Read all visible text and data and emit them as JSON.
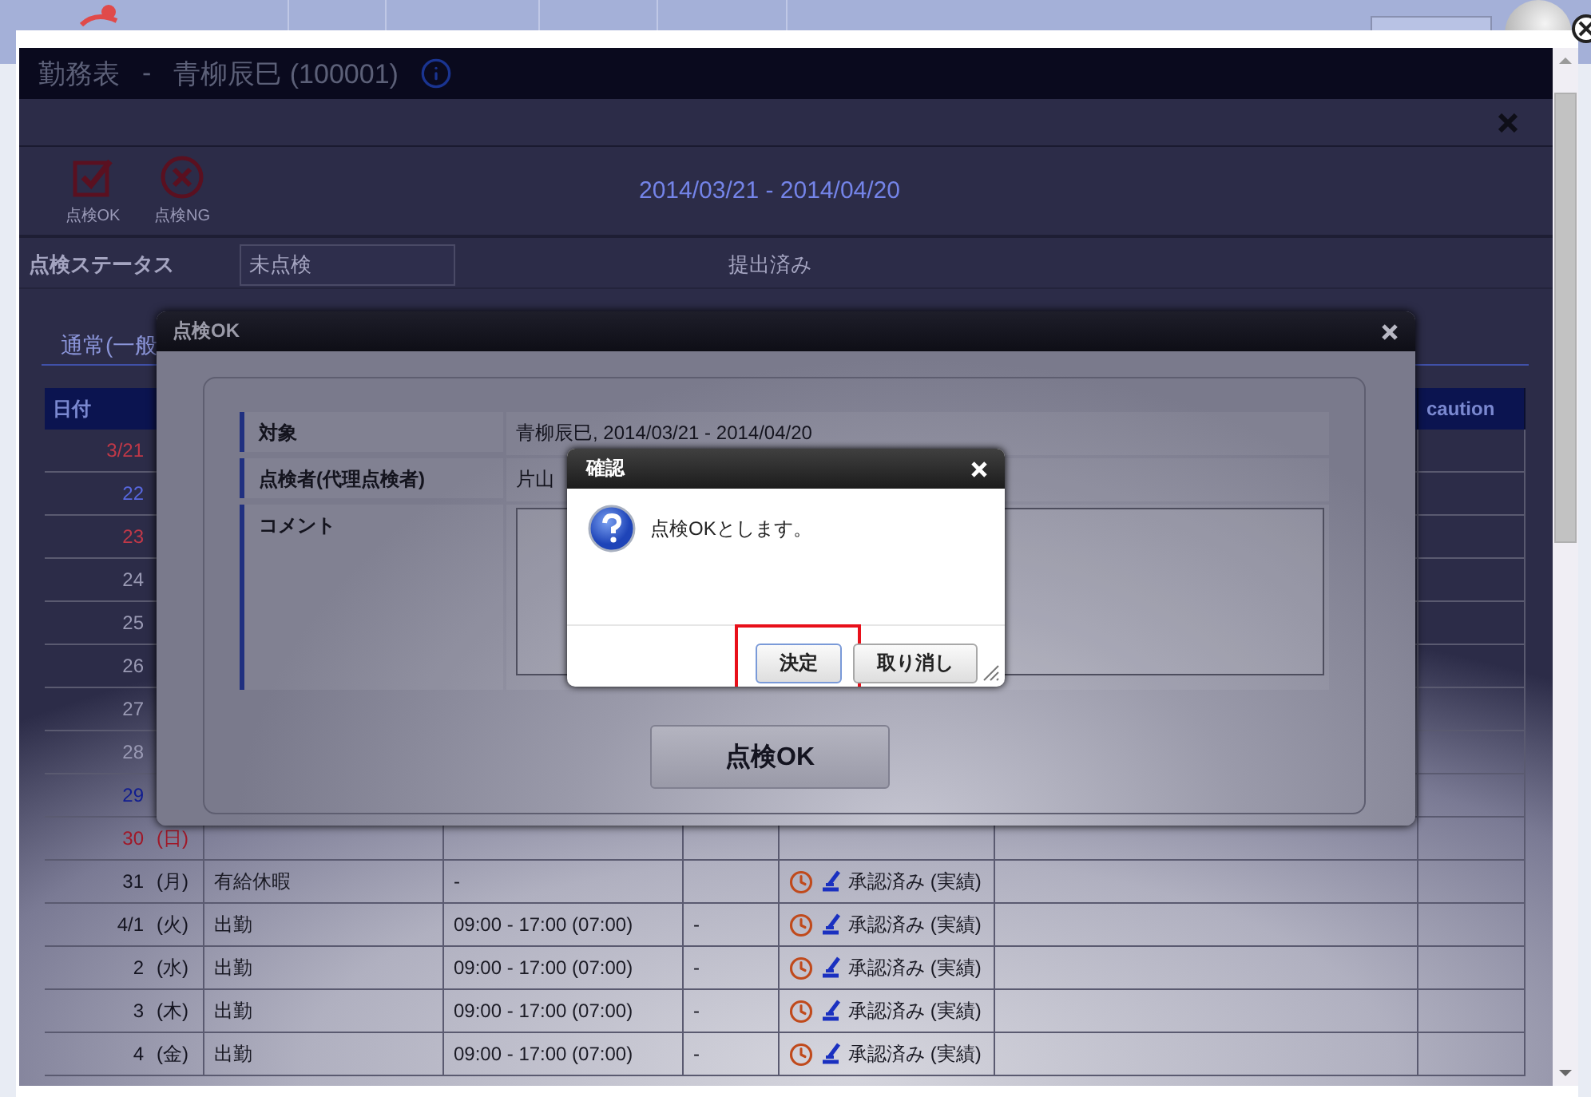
{
  "window": {
    "title": "勤務表",
    "separator": "-",
    "user": "青柳辰巳 (100001)",
    "period": "2014/03/21 - 2014/04/20",
    "actions": [
      {
        "label": "点検OK",
        "kind": "check"
      },
      {
        "label": "点検NG",
        "kind": "reject"
      }
    ],
    "status": {
      "label": "点検ステータス",
      "value": "未点検",
      "submission": "提出済み"
    },
    "section_title": "通常(一般",
    "table": {
      "date_header": "日付",
      "caution_header": "caution",
      "rows": [
        {
          "date": "3/21",
          "color": "#c03848"
        },
        {
          "date": "22",
          "color": "#5868e0"
        },
        {
          "date": "23",
          "color": "#c03848"
        },
        {
          "date": "24",
          "color": "#9a9ab4"
        },
        {
          "date": "25",
          "color": "#9a9ab4"
        },
        {
          "date": "26",
          "color": "#9a9ab4"
        },
        {
          "date": "27",
          "color": "#9a9ab4"
        },
        {
          "date": "28",
          "color": "#9a9ab4"
        },
        {
          "date": "29",
          "color": "#101c90"
        },
        {
          "date": "30",
          "weekday": "(日)",
          "color": "#a01828"
        },
        {
          "date": "31",
          "weekday": "(月)",
          "color": "#141420",
          "work_type": "有給休暇",
          "time": "-",
          "status": "承認済み (実績)"
        },
        {
          "date": "4/1",
          "weekday": "(火)",
          "color": "#141420",
          "work_type": "出勤",
          "time": "09:00 - 17:00 (07:00)",
          "column_4": "-",
          "status": "承認済み (実績)"
        },
        {
          "date": "2",
          "weekday": "(水)",
          "color": "#141420",
          "work_type": "出勤",
          "time": "09:00 - 17:00 (07:00)",
          "column_4": "-",
          "status": "承認済み (実績)"
        },
        {
          "date": "3",
          "weekday": "(木)",
          "color": "#141420",
          "work_type": "出勤",
          "time": "09:00 - 17:00 (07:00)",
          "column_4": "-",
          "status": "承認済み (実績)"
        },
        {
          "date": "4",
          "weekday": "(金)",
          "color": "#141420",
          "work_type": "出勤",
          "time": "09:00 - 17:00 (07:00)",
          "column_4": "-",
          "status": "承認済み (実績)"
        }
      ]
    }
  },
  "check_dialog": {
    "title": "点検OK",
    "fields": [
      {
        "label": "対象",
        "kind": "text",
        "value": "青柳辰巳, 2014/03/21 - 2014/04/20"
      },
      {
        "label": "点検者(代理点検者)",
        "kind": "text",
        "value": "片山"
      },
      {
        "label": "コメント",
        "kind": "textarea"
      }
    ],
    "submit": "点検OK"
  },
  "confirm_dialog": {
    "title": "確認",
    "message": "点検OKとします。",
    "buttons": [
      {
        "label": "決定",
        "highlighted": true
      },
      {
        "label": "取り消し",
        "highlighted": false
      }
    ]
  }
}
